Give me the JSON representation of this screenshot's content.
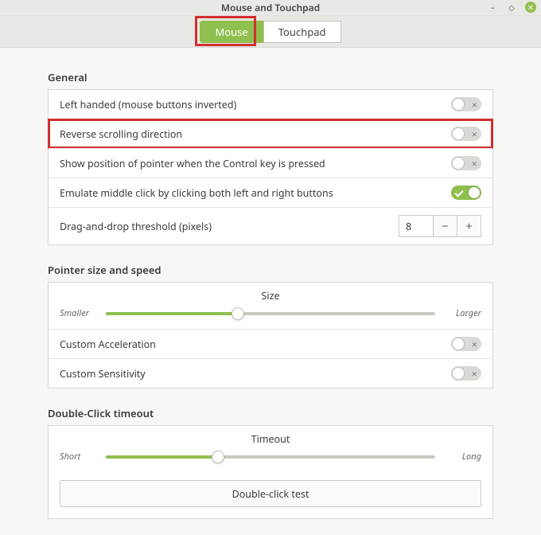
{
  "window": {
    "title": "Mouse and Touchpad"
  },
  "tabs": [
    {
      "label": "Mouse",
      "active": true
    },
    {
      "label": "Touchpad",
      "active": false
    }
  ],
  "sections": {
    "general": {
      "title": "General",
      "left_handed": {
        "label": "Left handed (mouse buttons inverted)",
        "on": false
      },
      "reverse_scroll": {
        "label": "Reverse scrolling direction",
        "on": false,
        "highlighted": true
      },
      "show_pointer_ctrl": {
        "label": "Show position of pointer when the Control key is pressed",
        "on": false
      },
      "emulate_middle": {
        "label": "Emulate middle click by clicking both left and right buttons",
        "on": true
      },
      "dnd_threshold": {
        "label": "Drag-and-drop threshold (pixels)",
        "value": "8"
      }
    },
    "pointer": {
      "title": "Pointer size and speed",
      "size_slider": {
        "title": "Size",
        "min_label": "Smaller",
        "max_label": "Larger",
        "value_pct": 40
      },
      "custom_accel": {
        "label": "Custom Acceleration",
        "on": false
      },
      "custom_sens": {
        "label": "Custom Sensitivity",
        "on": false
      }
    },
    "doubleclick": {
      "title": "Double-Click timeout",
      "timeout_slider": {
        "title": "Timeout",
        "min_label": "Short",
        "max_label": "Long",
        "value_pct": 34
      },
      "test_label": "Double-click test"
    }
  }
}
